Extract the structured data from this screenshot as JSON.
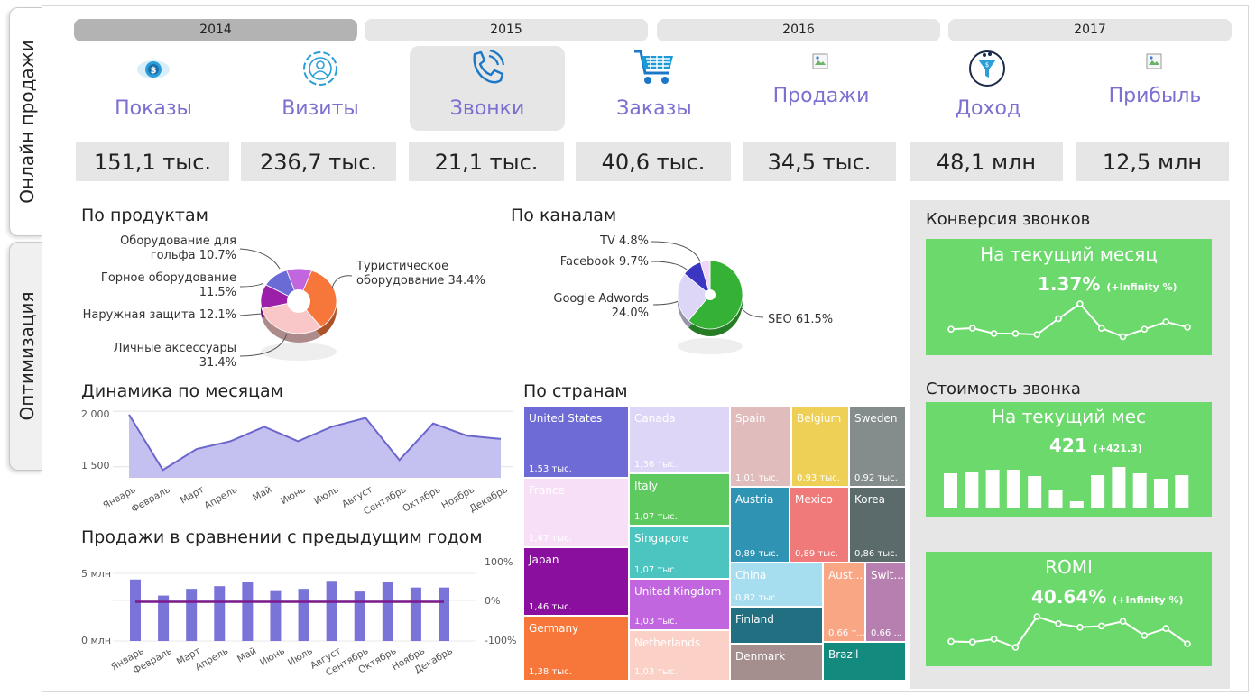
{
  "side_tabs": [
    "Онлайн продажи",
    "Оптимизация"
  ],
  "years": [
    "2014",
    "2015",
    "2016",
    "2017"
  ],
  "kpis": [
    {
      "label": "Показы",
      "value": "151,1 тыс.",
      "icon": "eye-dollar-icon"
    },
    {
      "label": "Визиты",
      "value": "236,7 тыс.",
      "icon": "visitor-icon"
    },
    {
      "label": "Звонки",
      "value": "21,1 тыс.",
      "icon": "phone-icon"
    },
    {
      "label": "Заказы",
      "value": "40,6 тыс.",
      "icon": "cart-icon"
    },
    {
      "label": "Продажи",
      "value": "34,5 тыс.",
      "icon": "broken-image-icon"
    },
    {
      "label": "Доход",
      "value": "48,1 млн",
      "icon": "funnel-icon"
    },
    {
      "label": "Прибыль",
      "value": "12,5 млн",
      "icon": "broken-image-icon"
    }
  ],
  "products": {
    "title": "По продуктам",
    "labels": [
      {
        "line1": "Оборудование для",
        "line2": "гольфа 10.7%"
      },
      {
        "line1": "Горное оборудование",
        "line2": "11.5%"
      },
      {
        "line1": "Наружная защита 12.1%",
        "line2": ""
      },
      {
        "line1": "Личные аксессуары",
        "line2": "31.4%"
      },
      {
        "line1": "Туристическое",
        "line2": "оборудование 34.4%"
      }
    ]
  },
  "channels": {
    "title": "По каналам",
    "labels": [
      {
        "line1": "TV 4.8%",
        "line2": ""
      },
      {
        "line1": "Facebook 9.7%",
        "line2": ""
      },
      {
        "line1": "Google Adwords",
        "line2": "24.0%"
      },
      {
        "line1": "SEO 61.5%",
        "line2": ""
      }
    ]
  },
  "monthly": {
    "title": "Динамика по месяцам",
    "y_ticks": [
      "2 000",
      "1 500"
    ],
    "months": [
      "Январь",
      "Февраль",
      "Март",
      "Апрель",
      "Май",
      "Июнь",
      "Июль",
      "Август",
      "Сентябрь",
      "Октябрь",
      "Ноябрь",
      "Декабрь"
    ]
  },
  "compare": {
    "title": "Продажи в сравнении с предыдущим годом",
    "y_left": [
      "5 млн",
      "0 млн"
    ],
    "y_right": [
      "100%",
      "0%",
      "-100%"
    ]
  },
  "countries": {
    "title": "По странам",
    "items": [
      {
        "name": "United States",
        "value": "1,53 тыс.",
        "color": "#6f6bd6"
      },
      {
        "name": "France",
        "value": "1,47 тыс.",
        "color": "#f7e0f7"
      },
      {
        "name": "Japan",
        "value": "1,46 тыс.",
        "color": "#8b0f9e"
      },
      {
        "name": "Germany",
        "value": "1,38 тыс.",
        "color": "#f7763a"
      },
      {
        "name": "Canada",
        "value": "1,36 тыс.",
        "color": "#ddd6f7"
      },
      {
        "name": "Italy",
        "value": "1,07 тыс.",
        "color": "#5ec95e"
      },
      {
        "name": "Singapore",
        "value": "1,07 тыс.",
        "color": "#4cc4c0"
      },
      {
        "name": "United Kingdom",
        "value": "1,03 тыс.",
        "color": "#c266e0"
      },
      {
        "name": "Netherlands",
        "value": "1,03 тыс.",
        "color": "#fbd0c6"
      },
      {
        "name": "Spain",
        "value": "1,01 тыс.",
        "color": "#e0bcbc"
      },
      {
        "name": "Belgium",
        "value": "0,93 тыс.",
        "color": "#efd057"
      },
      {
        "name": "Sweden",
        "value": "0,92 тыс.",
        "color": "#848c8c"
      },
      {
        "name": "Austria",
        "value": "0,89 тыс.",
        "color": "#2f93b3"
      },
      {
        "name": "Mexico",
        "value": "0,89 тыс.",
        "color": "#f07a7a"
      },
      {
        "name": "Korea",
        "value": "0,86 тыс.",
        "color": "#5b6b6b"
      },
      {
        "name": "China",
        "value": "0,82 тыс.",
        "color": "#a6def0"
      },
      {
        "name": "Aust...",
        "value": "0,66 т...",
        "color": "#f9a684"
      },
      {
        "name": "Swit...",
        "value": "0,66 ...",
        "color": "#b67fb0"
      },
      {
        "name": "Finland",
        "value": "",
        "color": "#236f82"
      },
      {
        "name": "Denmark",
        "value": "",
        "color": "#a58e8e"
      },
      {
        "name": "Brazil",
        "value": "",
        "color": "#128a7e"
      }
    ]
  },
  "right": {
    "conv_title": "Конверсия звонков",
    "conv_card_title": "На текущий месяц",
    "conv_value": "1.37%",
    "conv_sub": "(+Infinity %)",
    "cost_title": "Стоимость звонка",
    "cost_card_title": "На текущий мес",
    "cost_value": "421",
    "cost_sub": "(+421.3)",
    "romi_title": "ROMI",
    "romi_value": "40.64%",
    "romi_sub": "(+Infinity %)"
  },
  "colors": {
    "accent": "#7b6fd0",
    "card_green": "#6cd96c",
    "area_fill": "#c4c0f0",
    "area_line": "#6b66cc",
    "bar": "#7b74d8",
    "ref_line": "#7a1a8c"
  },
  "chart_data": [
    {
      "type": "area",
      "title": "Динамика по месяцам",
      "categories": [
        "Январь",
        "Февраль",
        "Март",
        "Апрель",
        "Май",
        "Июнь",
        "Июль",
        "Август",
        "Сентябрь",
        "Октябрь",
        "Ноябрь",
        "Декабрь"
      ],
      "values": [
        1970,
        1470,
        1660,
        1730,
        1860,
        1730,
        1860,
        1940,
        1560,
        1890,
        1780,
        1750
      ],
      "ylim": [
        1400,
        2050
      ],
      "grid": true
    },
    {
      "type": "bar",
      "title": "Продажи в сравнении с предыдущим годом",
      "categories": [
        "Январь",
        "Февраль",
        "Март",
        "Апрель",
        "Май",
        "Июнь",
        "Июль",
        "Август",
        "Сентябрь",
        "Октябрь",
        "Ноябрь",
        "Декабрь"
      ],
      "series": [
        {
          "values": [
            4.6,
            3.4,
            3.9,
            4.1,
            4.4,
            3.8,
            3.9,
            4.5,
            3.7,
            4.4,
            4.0,
            4.0
          ]
        }
      ],
      "secondary_line_pct": [
        0,
        0,
        0,
        0,
        0,
        0,
        0,
        0,
        0,
        0,
        0,
        0
      ],
      "ylim": [
        0,
        6
      ],
      "y2lim": [
        -100,
        100
      ]
    },
    {
      "type": "pie",
      "title": "По продуктам",
      "labels": [
        "Туристическое оборудование",
        "Личные аксессуары",
        "Наружная защита",
        "Горное оборудование",
        "Оборудование для гольфа"
      ],
      "values": [
        34.4,
        31.4,
        12.1,
        11.5,
        10.7
      ],
      "colors": [
        "#f7763a",
        "#f9c7c7",
        "#9b1fa8",
        "#6b6bd6",
        "#c266e0"
      ]
    },
    {
      "type": "pie",
      "title": "По каналам",
      "labels": [
        "SEO",
        "Google Adwords",
        "Facebook",
        "TV"
      ],
      "values": [
        61.5,
        24.0,
        9.7,
        4.8
      ],
      "colors": [
        "#35b235",
        "#ddd6f7",
        "#3b36c2",
        "#f0d6f7"
      ]
    },
    {
      "type": "line",
      "title": "Конверсия звонков",
      "values": [
        5,
        5.5,
        3,
        3,
        2.5,
        10,
        17,
        5.5,
        1.5,
        5,
        8.5,
        6
      ]
    },
    {
      "type": "bar",
      "title": "Стоимость звонка",
      "values": [
        38,
        40,
        42,
        42,
        35,
        19,
        7,
        36,
        45,
        38,
        32,
        36
      ]
    },
    {
      "type": "line",
      "title": "ROMI",
      "values": [
        5,
        4.5,
        7,
        0,
        26,
        20,
        17,
        18,
        22,
        10,
        16,
        3
      ]
    }
  ]
}
